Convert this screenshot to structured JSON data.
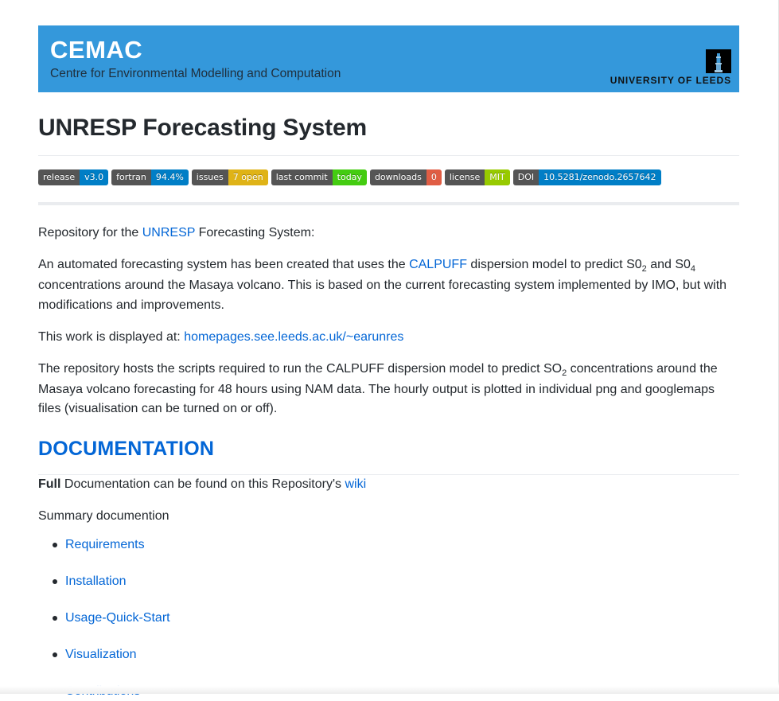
{
  "banner": {
    "title": "CEMAC",
    "subtitle": "Centre for Environmental Modelling and Computation",
    "banner_color": "#3498db",
    "university_logo_text": "UNIVERSITY OF LEEDS",
    "logo_icon": "leeds-tower-icon"
  },
  "page_title": "UNRESP Forecasting System",
  "badges": [
    {
      "label": "release",
      "value": "v3.0",
      "value_color": "#007ec6"
    },
    {
      "label": "fortran",
      "value": "94.4%",
      "value_color": "#007ec6"
    },
    {
      "label": "issues",
      "value": "7 open",
      "value_color": "#dfb317"
    },
    {
      "label": "last commit",
      "value": "today",
      "value_color": "#44cc11"
    },
    {
      "label": "downloads",
      "value": "0",
      "value_color": "#e05d44"
    },
    {
      "label": "license",
      "value": "MIT",
      "value_color": "#97ca00"
    },
    {
      "label": "DOI",
      "value": "10.5281/zenodo.2657642",
      "value_color": "#007ec6"
    }
  ],
  "paragraphs": {
    "repo_intro_prefix": "Repository for the ",
    "repo_intro_link": "UNRESP",
    "repo_intro_suffix": " Forecasting System:",
    "automated_1": "An automated forecasting system has been created that uses the ",
    "automated_link": "CALPUFF",
    "automated_2": " dispersion model to predict S0",
    "automated_sub1": "2",
    "automated_3": " and S0",
    "automated_sub2": "4",
    "automated_4": " concentrations around the Masaya volcano. This is based on the current forecasting system implemented by IMO, but with modifications and improvements.",
    "displayed_prefix": "This work is displayed at: ",
    "displayed_link": "homepages.see.leeds.ac.uk/~earunres",
    "hosts_1": "The repository hosts the scripts required to run the CALPUFF dispersion model to predict SO",
    "hosts_sub": "2",
    "hosts_2": " concentrations around the Masaya volcano forecasting for 48 hours using NAM data. The hourly output is plotted in individual png and googlemaps files (visualisation can be turned on or off)."
  },
  "documentation": {
    "heading": "DOCUMENTATION",
    "full_bold": "Full",
    "full_rest": " Documentation can be found on this Repository's ",
    "wiki_link": "wiki",
    "summary_text": "Summary documention",
    "items": [
      {
        "label": "Requirements"
      },
      {
        "label": "Installation"
      },
      {
        "label": "Usage-Quick-Start"
      },
      {
        "label": "Visualization"
      },
      {
        "label": "Contributions"
      }
    ]
  },
  "colors": {
    "link": "#0366d6",
    "text": "#24292e",
    "rule": "#eaecef"
  }
}
